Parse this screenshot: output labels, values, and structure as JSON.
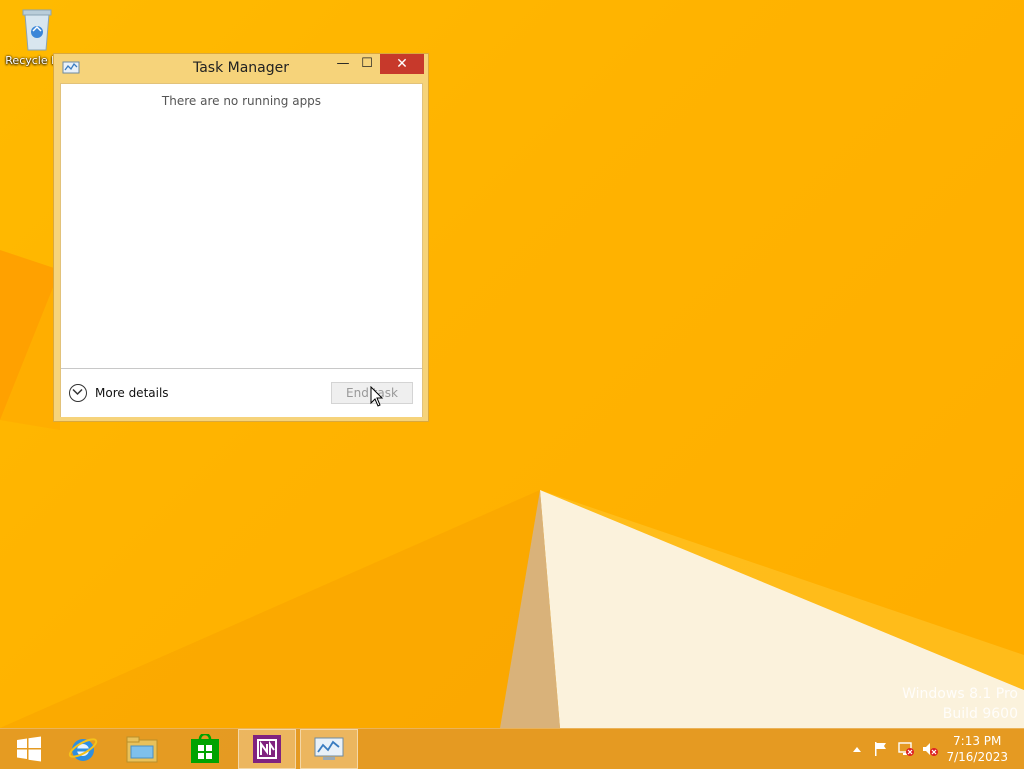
{
  "desktop": {
    "icons": [
      {
        "label": "Recycle Bin",
        "icon": "recycle-bin-icon"
      }
    ],
    "watermark": {
      "line1": "Windows 8.1 Pro",
      "line2": "Build 9600"
    }
  },
  "window": {
    "title": "Task Manager",
    "controls": {
      "minimize": "—",
      "maximize": "☐",
      "close": "✕"
    },
    "empty_message": "There are no running apps",
    "more_details_label": "More details",
    "end_task_label": "End task"
  },
  "taskbar": {
    "items": [
      {
        "name": "start",
        "icon": "windows-logo-icon"
      },
      {
        "name": "internet-explorer",
        "icon": "ie-icon"
      },
      {
        "name": "file-explorer",
        "icon": "folder-icon"
      },
      {
        "name": "store",
        "icon": "store-icon"
      },
      {
        "name": "onenote",
        "icon": "onenote-icon"
      },
      {
        "name": "task-manager",
        "icon": "task-manager-icon"
      }
    ],
    "tray_icons": [
      "chevron-up-icon",
      "flag-icon",
      "network-icon",
      "speaker-muted-icon"
    ],
    "clock": {
      "time": "7:13 PM",
      "date": "7/16/2023"
    }
  },
  "colors": {
    "accent": "#ffb400",
    "close": "#c7392b",
    "taskbar": "#e2972a"
  }
}
